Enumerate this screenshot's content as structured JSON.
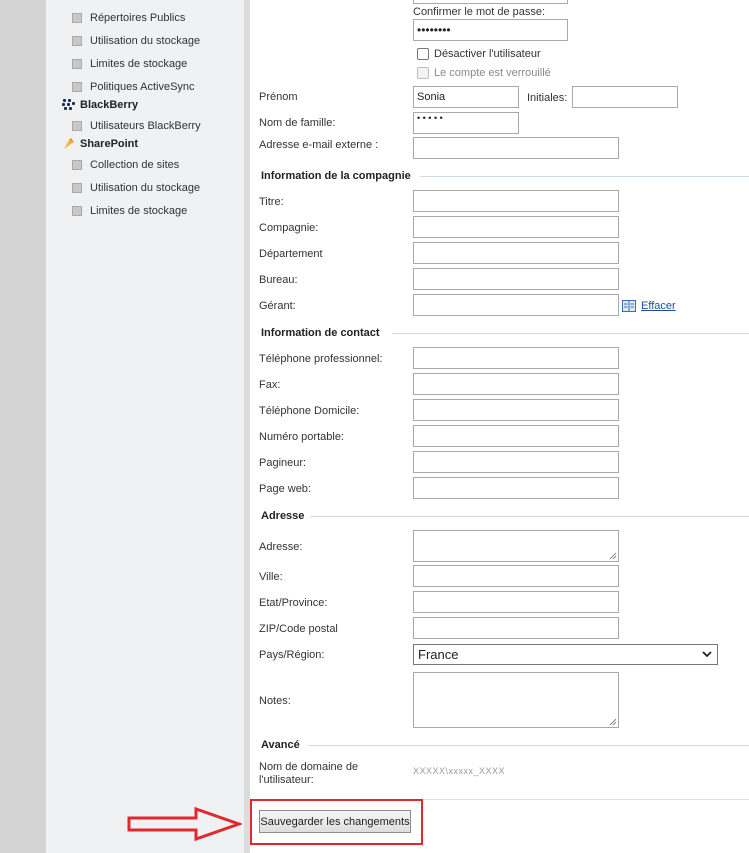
{
  "sidebar": {
    "items_exchange": [
      "Répertoires Publics",
      "Utilisation du stockage",
      "Limites de stockage",
      "Politiques ActiveSync"
    ],
    "blackberry": {
      "label": "BlackBerry",
      "items": [
        "Utilisateurs BlackBerry"
      ]
    },
    "sharepoint": {
      "label": "SharePoint",
      "items": [
        "Collection de sites",
        "Utilisation du stockage",
        "Limites de stockage"
      ]
    }
  },
  "form": {
    "confirm_password_label": "Confirmer le mot de passe:",
    "confirm_password_value": "••••••••",
    "disable_user_label": "Désactiver l'utilisateur",
    "account_locked_label": "Le compte est verrouillé",
    "first_name_label": "Prénom",
    "first_name_value": "Sonia",
    "initials_label": "Initiales:",
    "last_name_label": "Nom de famille:",
    "last_name_value": "• • • • •",
    "external_email_label": "Adresse e-mail externe :",
    "company_section": "Information de la compagnie",
    "title_label": "Titre:",
    "company_label": "Compagnie:",
    "department_label": "Département",
    "office_label": "Bureau:",
    "manager_label": "Gérant:",
    "clear_link": "Effacer",
    "contact_section": "Information de contact",
    "work_phone_label": "Téléphone professionnel:",
    "fax_label": "Fax:",
    "home_phone_label": "Téléphone Domicile:",
    "mobile_label": "Numéro portable:",
    "pager_label": "Pagineur:",
    "web_label": "Page web:",
    "address_section": "Adresse",
    "address_label": "Adresse:",
    "city_label": "Ville:",
    "state_label": "Etat/Province:",
    "zip_label": "ZIP/Code postal",
    "country_label": "Pays/Région:",
    "country_value": "France",
    "notes_label": "Notes:",
    "advanced_section": "Avancé",
    "domain_name_label_1": "Nom de domaine de",
    "domain_name_label_2": "l'utilisateur:",
    "domain_name_value": "XXXXX\\xxxxx_XXXX"
  },
  "actions": {
    "save_label": "Sauvegarder les changements"
  },
  "colors": {
    "annotation_red": "#e0282e",
    "link_blue": "#1f4e99"
  }
}
